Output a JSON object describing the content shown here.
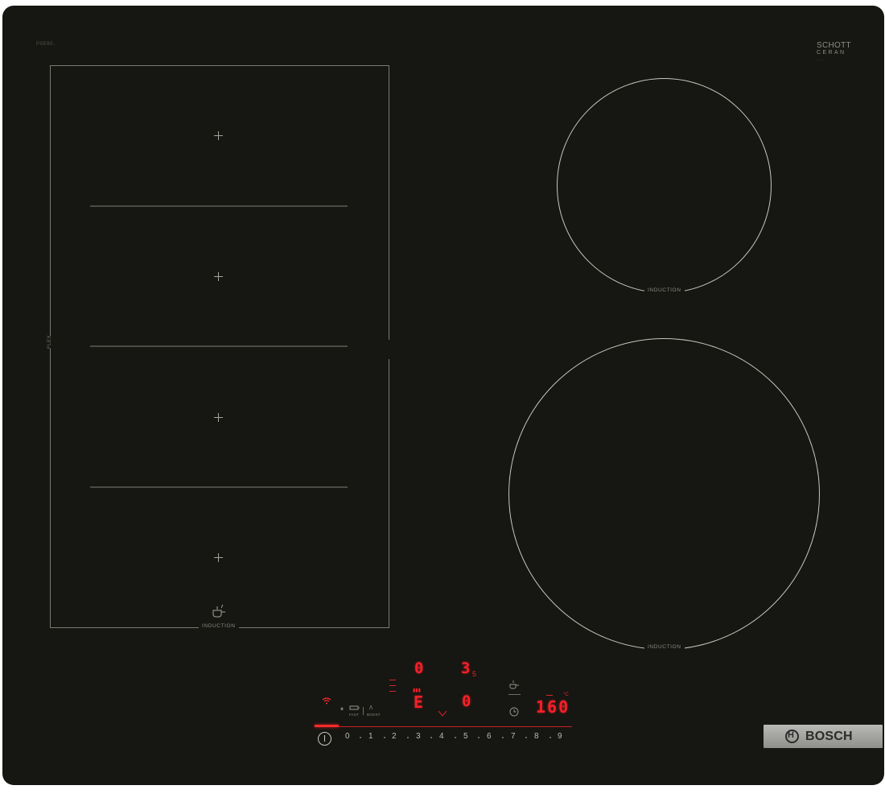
{
  "product": {
    "model_code": "PXE60..",
    "schott": {
      "line1": "SCHOTT",
      "line2": "CERAN",
      "line3": "········"
    },
    "brand": "BOSCH"
  },
  "zones": {
    "flex_label": "FLEX",
    "flex_zone_label": "INDUCTION",
    "top_ring_label": "INDUCTION",
    "bottom_ring_label": "INDUCTION"
  },
  "display": {
    "top_left_digit": "0",
    "top_right_digit": "3",
    "top_right_sub": "5",
    "bottom_left_digit": "E",
    "bottom_right_digit": "0",
    "timer_value": "160",
    "timer_unit": "°C",
    "left_small_label": "I min",
    "status_fast": "FAST",
    "status_boost": "BOOST"
  },
  "slider": {
    "levels": [
      "0",
      "1",
      "2",
      "3",
      "4",
      "5",
      "6",
      "7",
      "8",
      "9"
    ],
    "fill_level": 0
  },
  "colors": {
    "glass": "#161612",
    "display_red": "#f5202a",
    "ring_line": "#c7c7c0",
    "badge_silver": "#a8a8a5"
  },
  "icons": [
    "power-icon",
    "wifi-icon",
    "pot-icon",
    "timer-icon",
    "boost-icon",
    "fast-icon",
    "lock-icon"
  ]
}
